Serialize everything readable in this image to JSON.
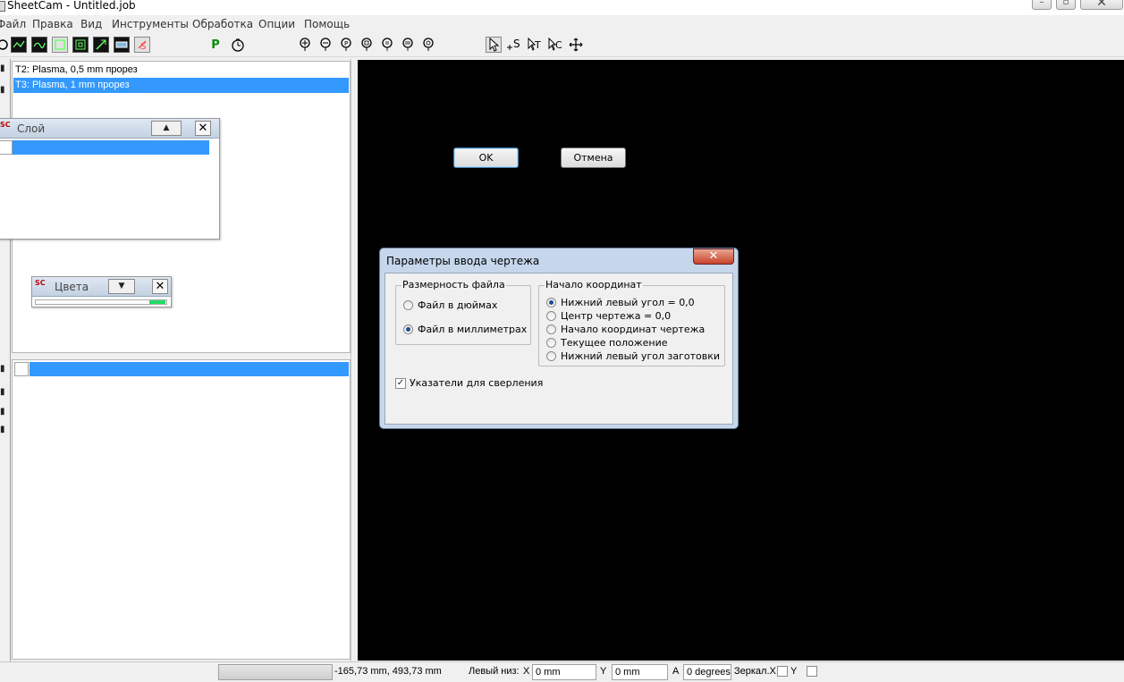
{
  "window": {
    "title": "SheetCam - Untitled.job",
    "min_label": "–",
    "max_label": "▫",
    "close_label": "✕"
  },
  "menu": [
    "Файл",
    "Правка",
    "Вид",
    "Инструменты",
    "Обработка",
    "Опции",
    "Помощь"
  ],
  "toolbar": {
    "post_label": "P",
    "timer_icon": "stopwatch-icon"
  },
  "tools_list": {
    "items": [
      {
        "label": "T2: Plasma, 0,5 mm прорез",
        "selected": false
      },
      {
        "label": "T3: Plasma, 1 mm прорез",
        "selected": true
      }
    ]
  },
  "layer_panel": {
    "title": "Слой",
    "button_label": "▲",
    "close_label": "✕"
  },
  "colors_panel": {
    "title": "Цвета",
    "button_label": "▼",
    "close_label": "✕"
  },
  "dialog": {
    "title": "Параметры ввода чертежа",
    "close_label": "✕",
    "file_units": {
      "legend": "Размерность файла",
      "options": [
        {
          "label": "Файл в дюймах",
          "selected": false
        },
        {
          "label": "Файл в миллиметрах",
          "selected": true
        }
      ]
    },
    "origin": {
      "legend": "Начало координат",
      "options": [
        {
          "label": "Нижний левый угол = 0,0",
          "selected": true
        },
        {
          "label": "Центр чертежа = 0,0",
          "selected": false
        },
        {
          "label": "Начало координат чертежа",
          "selected": false
        },
        {
          "label": "Текущее положение",
          "selected": false
        },
        {
          "label": "Нижний левый угол заготовки",
          "selected": false
        }
      ]
    },
    "drill_markers": {
      "label": "Указатели для сверления",
      "checked": true
    },
    "ok_label": "OK",
    "cancel_label": "Отмена"
  },
  "status": {
    "coords": "-165,73 mm, 493,73 mm",
    "origin_label": "Левый низ:",
    "x_label": "X",
    "x_value": "0 mm",
    "y_label": "Y",
    "y_value": "0 mm",
    "a_label": "A",
    "a_value": "0 degrees",
    "mirror_label": "Зеркал.X",
    "mirror_y_label": "Y"
  }
}
